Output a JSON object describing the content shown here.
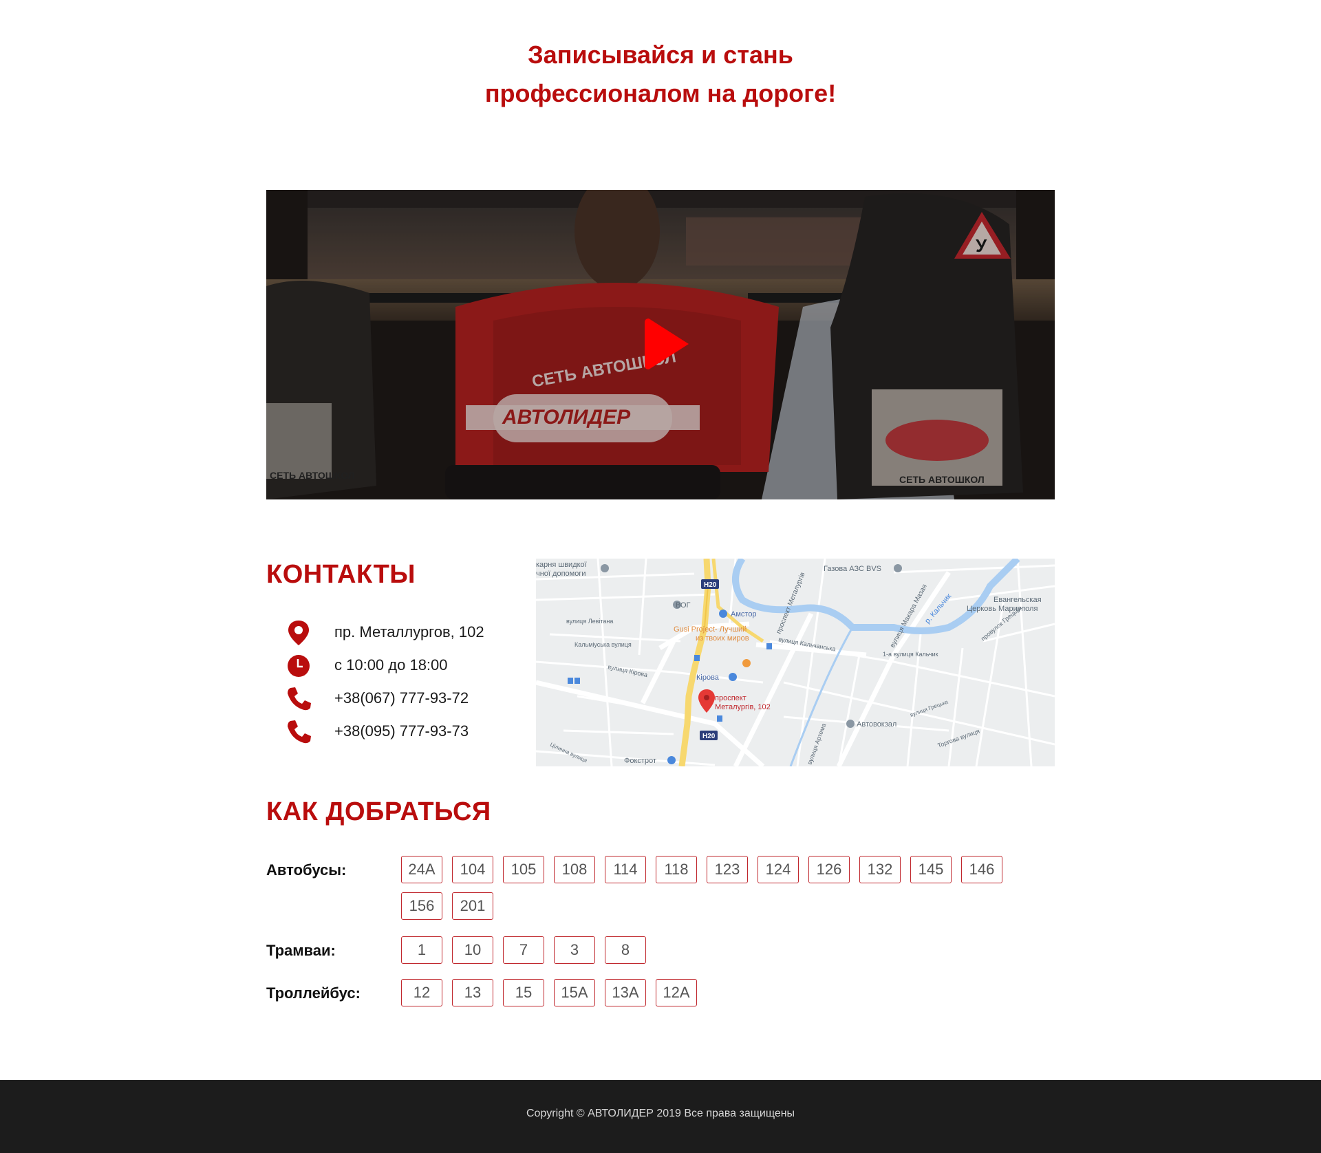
{
  "hero": {
    "title_line1": "Записывайся и стань",
    "title_line2": "профессионалом на дороге!"
  },
  "video": {
    "shirt_text_top": "СЕТЬ АВТОШКОЛ",
    "shirt_logo": "АВТОЛИДЕР",
    "seat_sign": "У",
    "seat_caption": "СЕТЬ АВТОШКОЛ",
    "play_icon": "play-icon",
    "play_color": "#ff0000"
  },
  "contacts": {
    "title": "КОНТАКТЫ",
    "items": [
      {
        "icon": "map-pin-icon",
        "text": "пр. Металлургов, 102"
      },
      {
        "icon": "clock-icon",
        "text": "с 10:00 до 18:00"
      },
      {
        "icon": "phone-icon",
        "text": "+38(067) 777-93-72"
      },
      {
        "icon": "phone-icon",
        "text": "+38(095) 777-93-73"
      }
    ]
  },
  "map": {
    "labels": {
      "ambulance": "карня швидкої",
      "ambulance2": "чної допомоги",
      "gas": "Газова АЗС BVS",
      "metal": "проспект Металургів",
      "makar": "вулиця Макара Мазая",
      "kalchyk": "р. Кальчик",
      "church1": "Евангельская",
      "church2": "Церковь Мариуполя",
      "vog": "ВОГ",
      "amstor": "Амстор",
      "levitana": "вулиця Левітана",
      "gusi1": "Gusi Project- Лучший",
      "gusi2": "из твоих миров",
      "kalch_st": "вулиця Кальчанська",
      "kalmius": "Кальміуська вулиця",
      "kalch1": "1-а вулиця Кальчик",
      "hretska": "провулок Грецька",
      "kirova_st": "вулиця Кірова",
      "kirova": "Кірова",
      "pin1": "проспект",
      "pin2": "Металургів, 102",
      "avtovokzal": "Автовокзал",
      "artema": "вулиця Артема",
      "torhova": "Торгова вулиця",
      "hretska2": "вулиця Грецька",
      "foxtrot": "Фокстрот",
      "tsel": "Цілинна вулиця",
      "h20a": "H20",
      "h20b": "H20"
    }
  },
  "routes": {
    "title": "КАК ДОБРАТЬСЯ",
    "groups": [
      {
        "label": "Автобусы:",
        "numbers": [
          "24А",
          "104",
          "105",
          "108",
          "114",
          "118",
          "123",
          "124",
          "126",
          "132",
          "145",
          "146",
          "156",
          "201"
        ]
      },
      {
        "label": "Трамваи:",
        "numbers": [
          "1",
          "10",
          "7",
          "3",
          "8"
        ]
      },
      {
        "label": "Троллейбус:",
        "numbers": [
          "12",
          "13",
          "15",
          "15А",
          "13А",
          "12А"
        ]
      }
    ]
  },
  "footer": {
    "copyright": "Copyright © АВТОЛИДЕР 2019 Все права защищены"
  },
  "colors": {
    "accent": "#b90d0d",
    "chip_border": "#c0272d",
    "footer_bg": "#1c1c1c"
  }
}
